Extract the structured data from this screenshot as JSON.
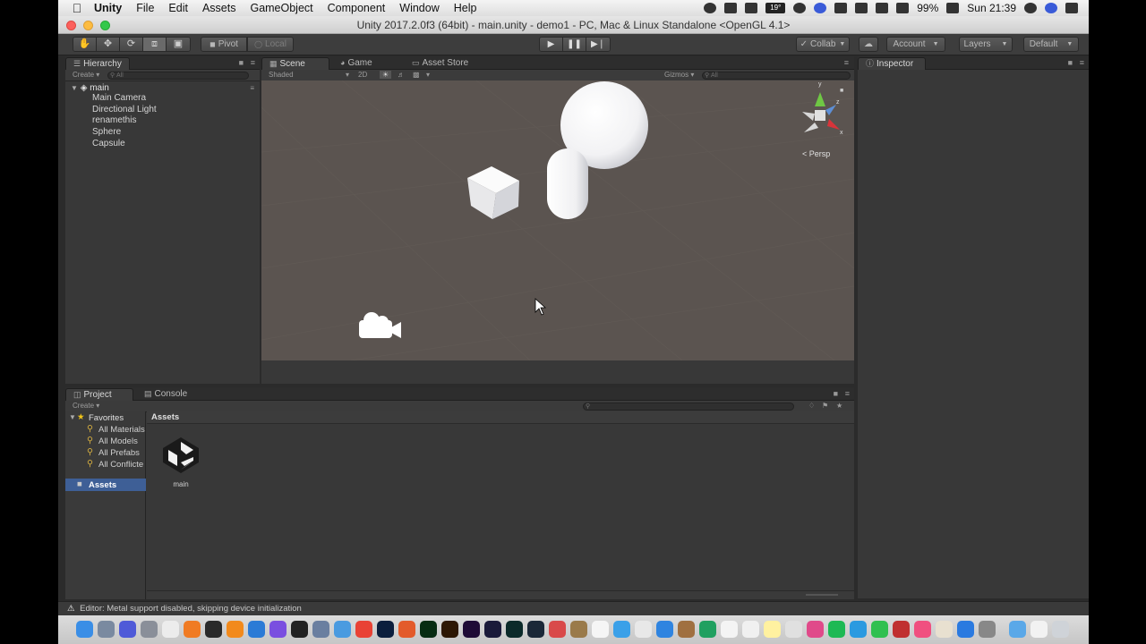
{
  "menubar": {
    "app_name": "Unity",
    "items": [
      "File",
      "Edit",
      "Assets",
      "GameObject",
      "Component",
      "Window",
      "Help"
    ],
    "temperature": "19°",
    "battery": "99%",
    "clock": "Sun 21:39"
  },
  "window": {
    "title": "Unity 2017.2.0f3 (64bit) - main.unity - demo1 - PC, Mac & Linux Standalone <OpenGL 4.1>"
  },
  "toolbar": {
    "pivot_label": "Pivot",
    "local_label": "Local",
    "collab_label": "Collab",
    "account_label": "Account",
    "layers_label": "Layers",
    "layout_label": "Default"
  },
  "hierarchy": {
    "tab_label": "Hierarchy",
    "create_label": "Create",
    "search_placeholder": "All",
    "scene_name": "main",
    "items": [
      "Main Camera",
      "Directional Light",
      "renamethis",
      "Sphere",
      "Capsule"
    ]
  },
  "scene_tabs": {
    "scene": "Scene",
    "game": "Game",
    "asset_store": "Asset Store"
  },
  "scene_toolbar": {
    "shading_mode": "Shaded",
    "mode_2d": "2D",
    "gizmos_label": "Gizmos",
    "search_placeholder": "All"
  },
  "scene_gizmo": {
    "projection": "Persp",
    "axis_y": "y",
    "axis_z": "z",
    "axis_x": "x"
  },
  "inspector": {
    "tab_label": "Inspector"
  },
  "project": {
    "tab_project": "Project",
    "tab_console": "Console",
    "create_label": "Create",
    "favorites_label": "Favorites",
    "favorites": [
      "All Materials",
      "All Models",
      "All Prefabs",
      "All Conflicte"
    ],
    "assets_folder": "Assets",
    "breadcrumb": "Assets",
    "asset_items": [
      {
        "name": "main"
      }
    ]
  },
  "status": {
    "message": "Editor: Metal support disabled, skipping device initialization"
  },
  "colors": {
    "scene_background": "#5b5450",
    "panel_background": "#383838",
    "selection": "#3e5f96"
  }
}
